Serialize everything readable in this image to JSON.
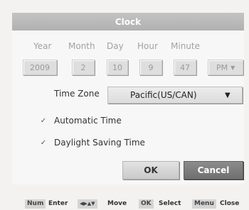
{
  "dialog": {
    "title": "Clock"
  },
  "columns": {
    "year": {
      "label": "Year",
      "value": "2009"
    },
    "month": {
      "label": "Month",
      "value": "2"
    },
    "day": {
      "label": "Day",
      "value": "10"
    },
    "hour": {
      "label": "Hour",
      "value": "9"
    },
    "minute": {
      "label": "Minute",
      "value": "47"
    },
    "ampm": {
      "value": "PM",
      "arrow": "▼"
    }
  },
  "timezone": {
    "label": "Time Zone",
    "value": "Pacific(US/CAN)",
    "arrow": "▼"
  },
  "options": {
    "automatic_time": {
      "label": "Automatic Time",
      "mark": "✓"
    },
    "dst": {
      "label": "Daylight Saving Time",
      "mark": "✓"
    }
  },
  "buttons": {
    "ok": "OK",
    "cancel": "Cancel"
  },
  "footer": {
    "num_key": "Num",
    "num_action": "Enter",
    "arrows_key": "◀▶▲▼",
    "arrows_action": "Move",
    "ok_key": "OK",
    "ok_action": "Select",
    "menu_key": "Menu",
    "menu_action": "Close"
  }
}
